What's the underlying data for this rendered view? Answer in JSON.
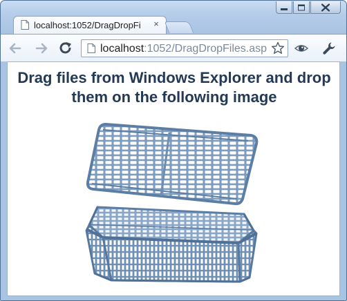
{
  "browser": {
    "tab": {
      "title": "localhost:1052/DragDropFi",
      "close_glyph": "×"
    },
    "address_bar": {
      "host": "localhost",
      "rest": ":1052/DragDropFiles.asp"
    },
    "icons": {
      "tab": "page-icon",
      "back": "back-arrow-icon",
      "forward": "forward-arrow-icon",
      "reload": "reload-icon",
      "page": "page-icon",
      "bookmark": "star-icon",
      "extension": "eye-icon",
      "settings": "wrench-icon",
      "minimize": "minimize-icon",
      "maximize": "maximize-icon",
      "close": "close-icon"
    },
    "colors": {
      "frame": "#b5cde9",
      "heading": "#233a57",
      "basket": "#6f8fb3"
    }
  },
  "page": {
    "heading": "Drag files from Windows Explorer and drop them on the following image",
    "drop_image": "basket-image"
  }
}
